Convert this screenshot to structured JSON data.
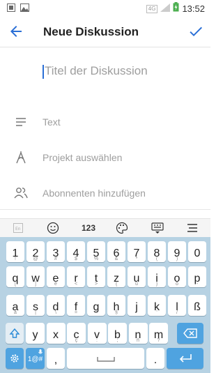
{
  "status_bar": {
    "network": "4G",
    "time": "13:52"
  },
  "app_bar": {
    "title": "Neue Diskussion",
    "back_icon": "arrow-back-icon",
    "confirm_icon": "checkmark-icon"
  },
  "form": {
    "title_placeholder": "Titel der Diskussion",
    "text_label": "Text",
    "project_label": "Projekt auswählen",
    "subscribers_label": "Abonnenten hinzufügen"
  },
  "keyboard": {
    "toolbar": {
      "numbers": "123"
    },
    "row1": [
      {
        "k": "1",
        "s": "!"
      },
      {
        "k": "2",
        "s": "@"
      },
      {
        "k": "3",
        "s": "#"
      },
      {
        "k": "4",
        "s": "$"
      },
      {
        "k": "5",
        "s": "%"
      },
      {
        "k": "6",
        "s": "&"
      },
      {
        "k": "7",
        "s": "*"
      },
      {
        "k": "8",
        "s": "("
      },
      {
        "k": "9",
        "s": ")"
      },
      {
        "k": "0",
        "s": ""
      }
    ],
    "row2": [
      {
        "k": "q",
        "s": "["
      },
      {
        "k": "w",
        "s": "]"
      },
      {
        "k": "e",
        "s": "é"
      },
      {
        "k": "r",
        "s": "<"
      },
      {
        "k": "t",
        "s": ">"
      },
      {
        "k": "z",
        "s": "{"
      },
      {
        "k": "u",
        "s": "ü"
      },
      {
        "k": "i",
        "s": "}"
      },
      {
        "k": "o",
        "s": "ö"
      },
      {
        "k": "p",
        "s": "-"
      }
    ],
    "row3": [
      {
        "k": "a",
        "s": "ä"
      },
      {
        "k": "s",
        "s": "|"
      },
      {
        "k": "d",
        "s": "\\"
      },
      {
        "k": "f",
        "s": "="
      },
      {
        "k": "g",
        "s": "^"
      },
      {
        "k": "h",
        "s": "§"
      },
      {
        "k": "j",
        "s": "\""
      },
      {
        "k": "k",
        "s": "'"
      },
      {
        "k": "l",
        "s": "/"
      },
      {
        "k": "ß",
        "s": ""
      }
    ],
    "row4": [
      {
        "k": "y",
        "s": ""
      },
      {
        "k": "x",
        "s": ""
      },
      {
        "k": "c",
        "s": "ç"
      },
      {
        "k": "v",
        "s": ":"
      },
      {
        "k": "b",
        "s": ";"
      },
      {
        "k": "n",
        "s": "ñ"
      },
      {
        "k": "m",
        "s": "?"
      }
    ],
    "symbols_key": "1@#",
    "comma_key": ",",
    "period_key": "."
  }
}
